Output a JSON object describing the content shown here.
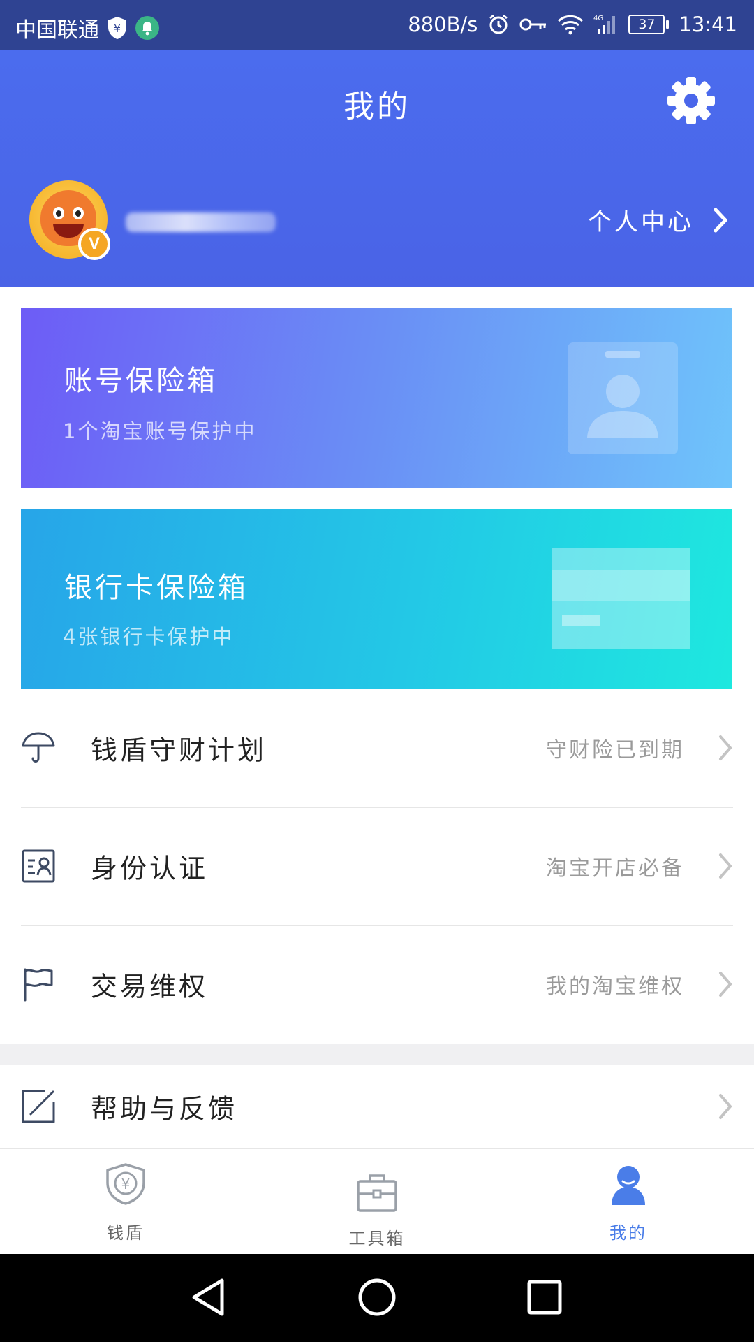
{
  "status_bar": {
    "carrier": "中国联通",
    "net_speed": "880B/s",
    "network": "4G",
    "battery": "37",
    "time": "13:41"
  },
  "header": {
    "title": "我的",
    "personal_center": "个人中心",
    "vip_badge": "V"
  },
  "cards": {
    "account": {
      "title": "账号保险箱",
      "subtitle": "1个淘宝账号保护中"
    },
    "bank": {
      "title": "银行卡保险箱",
      "subtitle": "4张银行卡保护中"
    }
  },
  "menu": [
    {
      "label": "钱盾守财计划",
      "value": "守财险已到期",
      "icon": "umbrella-icon"
    },
    {
      "label": "身份认证",
      "value": "淘宝开店必备",
      "icon": "id-card-icon"
    },
    {
      "label": "交易维权",
      "value": "我的淘宝维权",
      "icon": "flag-icon"
    },
    {
      "label": "帮助与反馈",
      "value": "",
      "icon": "edit-icon"
    }
  ],
  "tabs": [
    {
      "label": "钱盾",
      "icon": "shield-yen-icon",
      "active": false
    },
    {
      "label": "工具箱",
      "icon": "toolbox-icon",
      "active": false
    },
    {
      "label": "我的",
      "icon": "person-icon",
      "active": true
    }
  ],
  "colors": {
    "status_bar": "#2f4392",
    "header": "#4a66ea",
    "active_tab": "#4a7de8",
    "inactive_tab": "#9aa0a8"
  }
}
